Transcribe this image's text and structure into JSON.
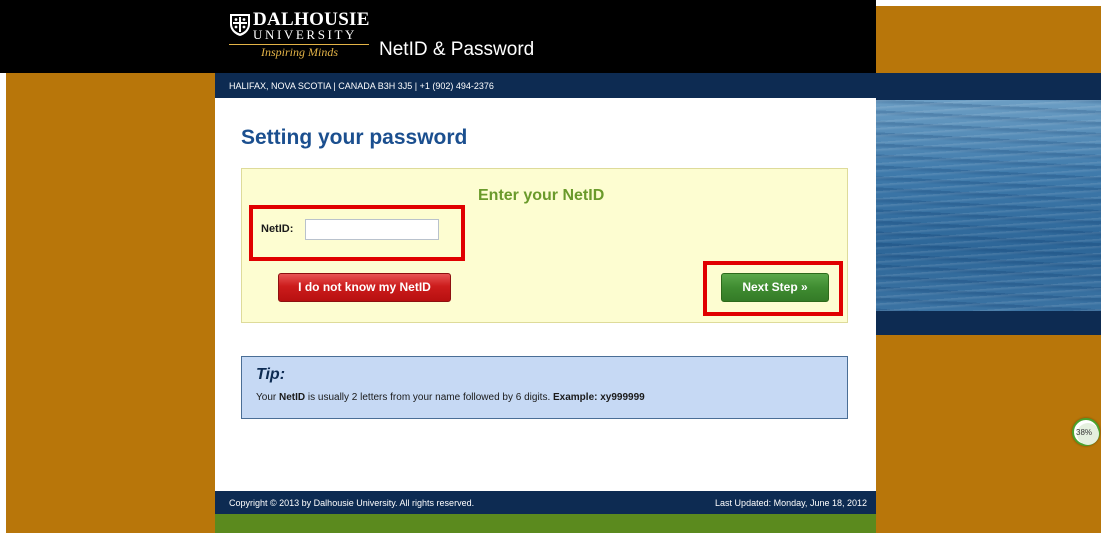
{
  "header": {
    "logo_name": "DALHOUSIE",
    "logo_sub": "UNIVERSITY",
    "logo_tagline": "Inspiring Minds",
    "title": "NetID & Password"
  },
  "address": "HALIFAX, NOVA SCOTIA | CANADA B3H 3J5 | +1 (902) 494-2376",
  "main": {
    "page_title": "Setting your password",
    "form": {
      "heading": "Enter your NetID",
      "netid_label": "NetID:",
      "netid_value": "",
      "unknown_button": "I do not know my NetID",
      "next_button": "Next Step »"
    },
    "tip": {
      "title": "Tip:",
      "text_1": "Your ",
      "text_bold_1": "NetID",
      "text_2": " is usually 2 letters from your name followed by 6 digits. ",
      "text_bold_2": "Example: xy999999"
    }
  },
  "footer": {
    "copyright": "Copyright © 2013 by Dalhousie University. All rights reserved.",
    "updated": "Last Updated: Monday, June 18, 2012"
  },
  "zoom": {
    "value": "38%"
  },
  "colors": {
    "gold": "#b8760a",
    "navy": "#0d2b52",
    "title_blue": "#1b4f8f",
    "heading_green": "#6a9a2b",
    "highlight_red": "#e00000",
    "button_red": "#cc1c1c",
    "button_green": "#3f8c31",
    "footer_green": "#5b8a1e"
  }
}
